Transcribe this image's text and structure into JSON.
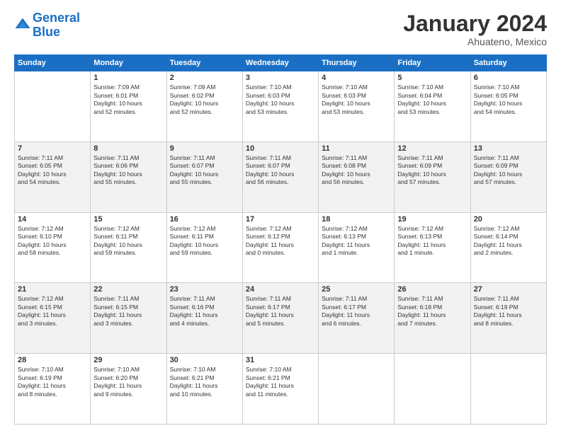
{
  "header": {
    "logo_line1": "General",
    "logo_line2": "Blue",
    "month": "January 2024",
    "location": "Ahuateno, Mexico"
  },
  "days_of_week": [
    "Sunday",
    "Monday",
    "Tuesday",
    "Wednesday",
    "Thursday",
    "Friday",
    "Saturday"
  ],
  "weeks": [
    [
      {
        "day": "",
        "info": ""
      },
      {
        "day": "1",
        "info": "Sunrise: 7:09 AM\nSunset: 6:01 PM\nDaylight: 10 hours\nand 52 minutes."
      },
      {
        "day": "2",
        "info": "Sunrise: 7:09 AM\nSunset: 6:02 PM\nDaylight: 10 hours\nand 52 minutes."
      },
      {
        "day": "3",
        "info": "Sunrise: 7:10 AM\nSunset: 6:03 PM\nDaylight: 10 hours\nand 53 minutes."
      },
      {
        "day": "4",
        "info": "Sunrise: 7:10 AM\nSunset: 6:03 PM\nDaylight: 10 hours\nand 53 minutes."
      },
      {
        "day": "5",
        "info": "Sunrise: 7:10 AM\nSunset: 6:04 PM\nDaylight: 10 hours\nand 53 minutes."
      },
      {
        "day": "6",
        "info": "Sunrise: 7:10 AM\nSunset: 6:05 PM\nDaylight: 10 hours\nand 54 minutes."
      }
    ],
    [
      {
        "day": "7",
        "info": "Sunrise: 7:11 AM\nSunset: 6:05 PM\nDaylight: 10 hours\nand 54 minutes."
      },
      {
        "day": "8",
        "info": "Sunrise: 7:11 AM\nSunset: 6:06 PM\nDaylight: 10 hours\nand 55 minutes."
      },
      {
        "day": "9",
        "info": "Sunrise: 7:11 AM\nSunset: 6:07 PM\nDaylight: 10 hours\nand 55 minutes."
      },
      {
        "day": "10",
        "info": "Sunrise: 7:11 AM\nSunset: 6:07 PM\nDaylight: 10 hours\nand 56 minutes."
      },
      {
        "day": "11",
        "info": "Sunrise: 7:11 AM\nSunset: 6:08 PM\nDaylight: 10 hours\nand 56 minutes."
      },
      {
        "day": "12",
        "info": "Sunrise: 7:11 AM\nSunset: 6:09 PM\nDaylight: 10 hours\nand 57 minutes."
      },
      {
        "day": "13",
        "info": "Sunrise: 7:11 AM\nSunset: 6:09 PM\nDaylight: 10 hours\nand 57 minutes."
      }
    ],
    [
      {
        "day": "14",
        "info": "Sunrise: 7:12 AM\nSunset: 6:10 PM\nDaylight: 10 hours\nand 58 minutes."
      },
      {
        "day": "15",
        "info": "Sunrise: 7:12 AM\nSunset: 6:11 PM\nDaylight: 10 hours\nand 59 minutes."
      },
      {
        "day": "16",
        "info": "Sunrise: 7:12 AM\nSunset: 6:11 PM\nDaylight: 10 hours\nand 59 minutes."
      },
      {
        "day": "17",
        "info": "Sunrise: 7:12 AM\nSunset: 6:12 PM\nDaylight: 11 hours\nand 0 minutes."
      },
      {
        "day": "18",
        "info": "Sunrise: 7:12 AM\nSunset: 6:13 PM\nDaylight: 11 hours\nand 1 minute."
      },
      {
        "day": "19",
        "info": "Sunrise: 7:12 AM\nSunset: 6:13 PM\nDaylight: 11 hours\nand 1 minute."
      },
      {
        "day": "20",
        "info": "Sunrise: 7:12 AM\nSunset: 6:14 PM\nDaylight: 11 hours\nand 2 minutes."
      }
    ],
    [
      {
        "day": "21",
        "info": "Sunrise: 7:12 AM\nSunset: 6:15 PM\nDaylight: 11 hours\nand 3 minutes."
      },
      {
        "day": "22",
        "info": "Sunrise: 7:11 AM\nSunset: 6:15 PM\nDaylight: 11 hours\nand 3 minutes."
      },
      {
        "day": "23",
        "info": "Sunrise: 7:11 AM\nSunset: 6:16 PM\nDaylight: 11 hours\nand 4 minutes."
      },
      {
        "day": "24",
        "info": "Sunrise: 7:11 AM\nSunset: 6:17 PM\nDaylight: 11 hours\nand 5 minutes."
      },
      {
        "day": "25",
        "info": "Sunrise: 7:11 AM\nSunset: 6:17 PM\nDaylight: 11 hours\nand 6 minutes."
      },
      {
        "day": "26",
        "info": "Sunrise: 7:11 AM\nSunset: 6:18 PM\nDaylight: 11 hours\nand 7 minutes."
      },
      {
        "day": "27",
        "info": "Sunrise: 7:11 AM\nSunset: 6:19 PM\nDaylight: 11 hours\nand 8 minutes."
      }
    ],
    [
      {
        "day": "28",
        "info": "Sunrise: 7:10 AM\nSunset: 6:19 PM\nDaylight: 11 hours\nand 8 minutes."
      },
      {
        "day": "29",
        "info": "Sunrise: 7:10 AM\nSunset: 6:20 PM\nDaylight: 11 hours\nand 9 minutes."
      },
      {
        "day": "30",
        "info": "Sunrise: 7:10 AM\nSunset: 6:21 PM\nDaylight: 11 hours\nand 10 minutes."
      },
      {
        "day": "31",
        "info": "Sunrise: 7:10 AM\nSunset: 6:21 PM\nDaylight: 11 hours\nand 11 minutes."
      },
      {
        "day": "",
        "info": ""
      },
      {
        "day": "",
        "info": ""
      },
      {
        "day": "",
        "info": ""
      }
    ]
  ]
}
